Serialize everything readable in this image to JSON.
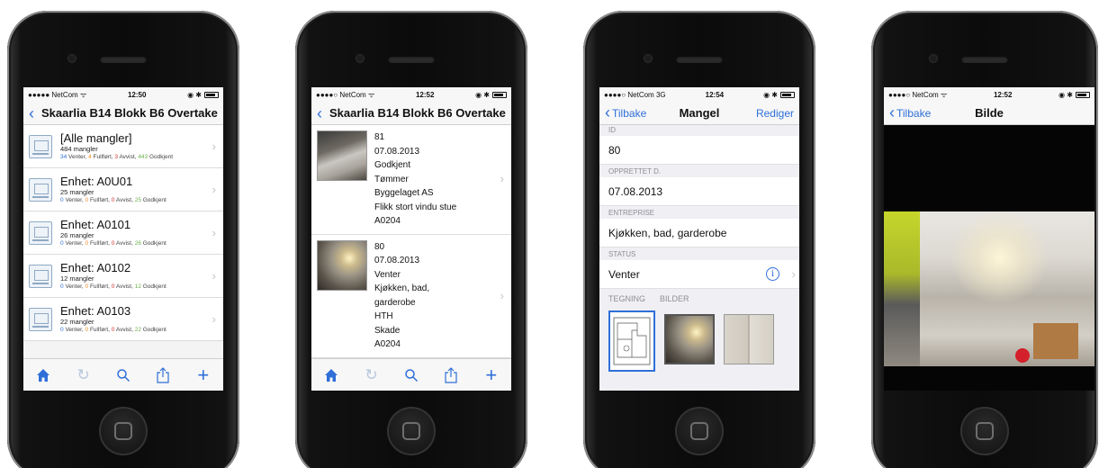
{
  "colors": {
    "accent": "#2f6fd8",
    "venter": "#2f6fd8",
    "fullfort": "#f08a24",
    "avvist": "#d0342c",
    "godkjent": "#6ab04c"
  },
  "icons": {
    "back": "chevron-left-icon",
    "home": "home-icon",
    "refresh": "refresh-icon",
    "search": "search-icon",
    "share": "share-icon",
    "add": "plus-icon",
    "info": "info-icon"
  },
  "screen1": {
    "status": {
      "carrier": "●●●●● NetCom ᯤ",
      "time": "12:50",
      "right": "◉ ✱"
    },
    "nav_title": "Skaarlia B14 Blokk B6 Overtake...",
    "rows": [
      {
        "title": "[Alle mangler]",
        "count": "484 mangler",
        "venter": "34",
        "fullfort": "4",
        "avvist": "3",
        "godkjent": "443"
      },
      {
        "title": "Enhet: A0U01",
        "count": "25 mangler",
        "venter": "0",
        "fullfort": "0",
        "avvist": "0",
        "godkjent": "25"
      },
      {
        "title": "Enhet: A0101",
        "count": "26 mangler",
        "venter": "0",
        "fullfort": "0",
        "avvist": "0",
        "godkjent": "26"
      },
      {
        "title": "Enhet: A0102",
        "count": "12 mangler",
        "venter": "0",
        "fullfort": "0",
        "avvist": "0",
        "godkjent": "12"
      },
      {
        "title": "Enhet: A0103",
        "count": "22 mangler",
        "venter": "0",
        "fullfort": "0",
        "avvist": "0",
        "godkjent": "22"
      }
    ],
    "labels": {
      "venter": "Venter,",
      "fullfort": "Fullført,",
      "avvist": "Avvist,",
      "godkjent": "Godkjent"
    }
  },
  "screen2": {
    "status": {
      "carrier": "●●●●○ NetCom ᯤ",
      "time": "12:52",
      "right": "◉ ✱"
    },
    "nav_title": "Skaarlia B14 Blokk B6 Overtake...",
    "defects": [
      {
        "l1": "81",
        "l2": "07.08.2013",
        "l3": "Godkjent",
        "l4": "Tømmer",
        "l5": "Byggelaget AS",
        "l6": "Flikk stort vindu stue",
        "l7": "A0204"
      },
      {
        "l1": "80",
        "l2": "07.08.2013",
        "l3": "Venter",
        "l4": "Kjøkken, bad,",
        "l5": "garderobe",
        "l6": "HTH",
        "l7": "Skade",
        "l8": "A0204"
      }
    ]
  },
  "screen3": {
    "status": {
      "carrier": "●●●●○ NetCom  3G",
      "time": "12:54",
      "right": "◉ ✱"
    },
    "back_label": "Tilbake",
    "title": "Mangel",
    "edit_label": "Rediger",
    "fields": [
      {
        "label": "ID",
        "value": "80"
      },
      {
        "label": "OPPRETTET D.",
        "value": "07.08.2013"
      },
      {
        "label": "ENTREPRISE",
        "value": "Kjøkken, bad, garderobe"
      },
      {
        "label": "STATUS",
        "value": "Venter"
      }
    ],
    "media_tabs": [
      "TEGNING",
      "BILDER"
    ]
  },
  "screen4": {
    "status": {
      "carrier": "●●●●○ NetCom ᯤ",
      "time": "12:52",
      "right": "◉ ✱"
    },
    "back_label": "Tilbake",
    "title": "Bilde"
  }
}
